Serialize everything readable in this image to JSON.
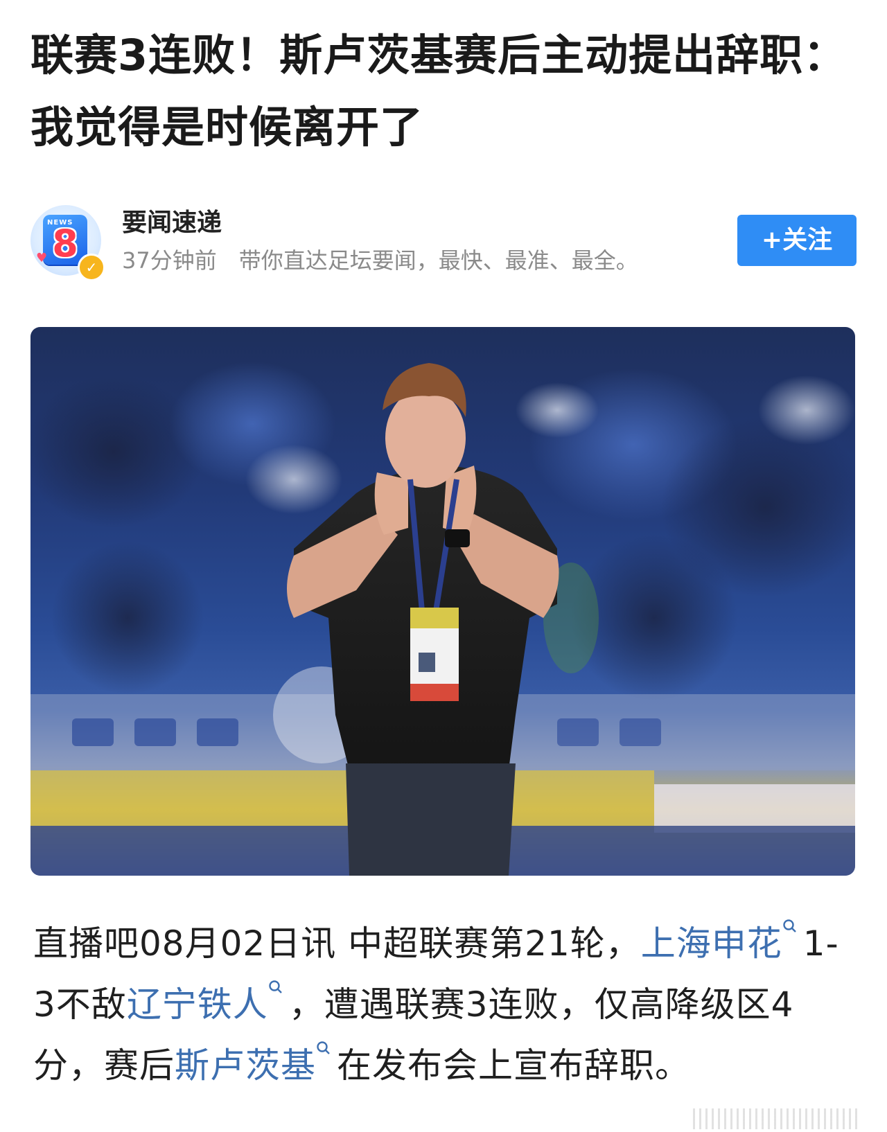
{
  "article": {
    "title": "联赛3连败！斯卢茨基赛后主动提出辞职：我觉得是时候离开了"
  },
  "author": {
    "avatar_text": "NEWS",
    "avatar_digit": "8",
    "name": "要闻速递",
    "time": "37分钟前",
    "tagline": "带你直达足坛要闻，最快、最准、最全。",
    "verified_icon": "verified-badge-icon"
  },
  "follow": {
    "label": "+关注",
    "color": "#2f8df5"
  },
  "photo": {
    "icon": "coach-photo"
  },
  "body": {
    "intro": "直播吧08月02日讯  中超联赛第21轮，",
    "team1": "上海申花",
    "score": "1-3不敌",
    "team2": "辽宁铁人",
    "mid": "，遭遇联赛3连败，仅高降级区4分，赛后",
    "coach": "斯卢茨基",
    "end": "在发布会上宣布辞职。",
    "link_color": "#3d6fb0"
  }
}
